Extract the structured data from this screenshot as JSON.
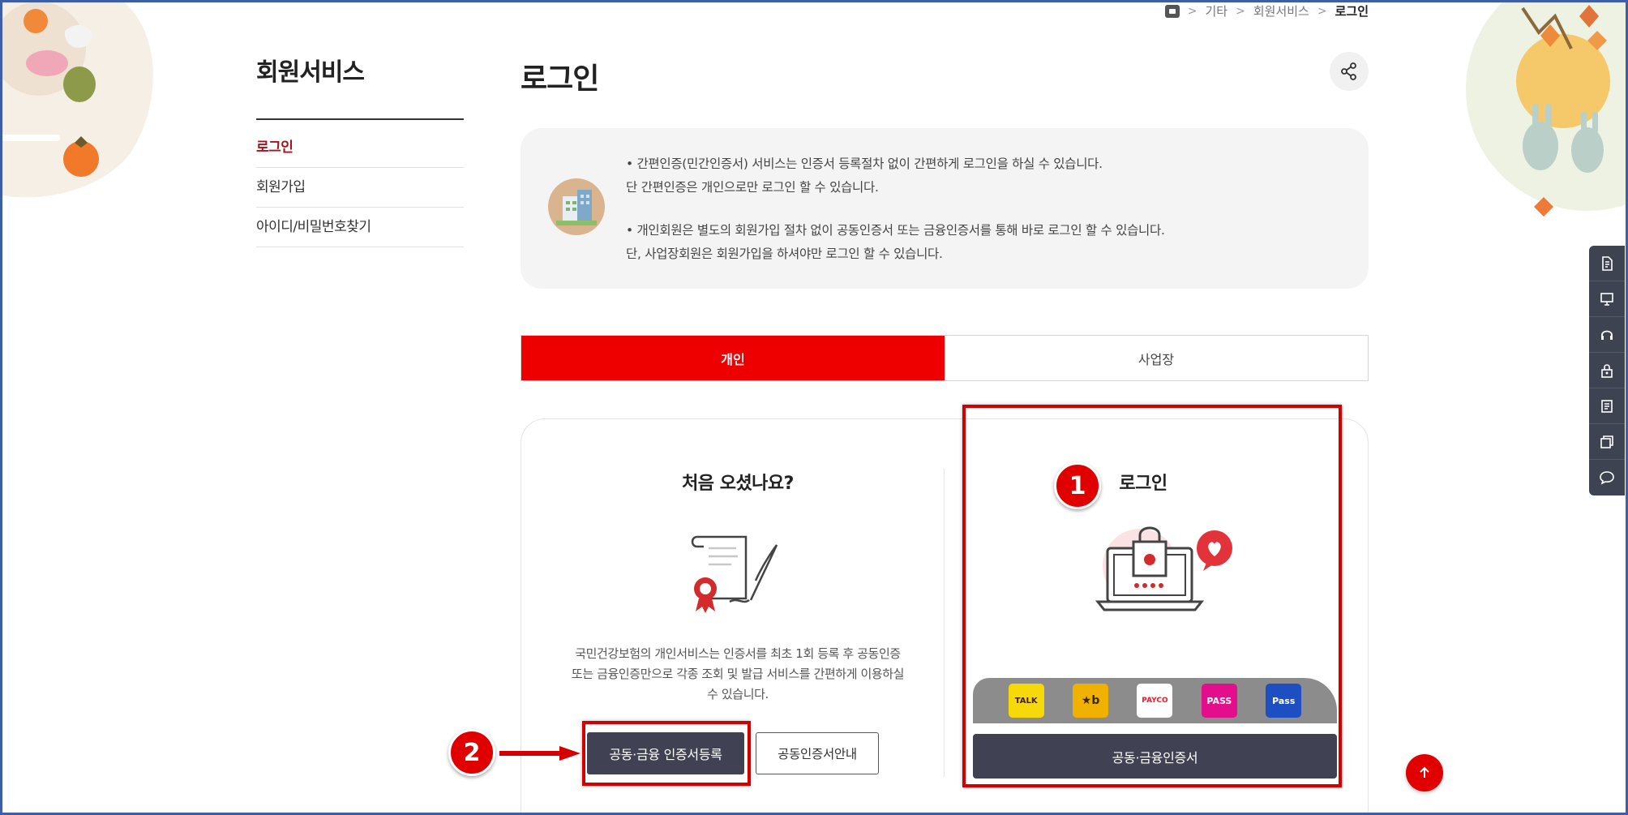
{
  "breadcrumb": {
    "items": [
      "기타",
      "회원서비스",
      "로그인"
    ]
  },
  "sidebar": {
    "title": "회원서비스",
    "items": [
      {
        "label": "로그인",
        "active": true
      },
      {
        "label": "회원가입",
        "active": false
      },
      {
        "label": "아이디/비밀번호찾기",
        "active": false
      }
    ]
  },
  "main": {
    "title": "로그인",
    "info": {
      "lines": [
        "• 간편인증(민간인증서) 서비스는 인증서 등록절차 없이 간편하게 로그인을 하실 수 있습니다.",
        "단 간편인증은 개인으로만 로그인 할 수 있습니다.",
        "• 개인회원은 별도의 회원가입 절차 없이 공동인증서 또는 금융인증서를 통해 바로 로그인 할 수 있습니다.",
        "단, 사업장회원은 회원가입을 하셔야만 로그인 할 수 있습니다."
      ]
    },
    "tabs": [
      {
        "label": "개인",
        "active": true
      },
      {
        "label": "사업장",
        "active": false
      }
    ],
    "first_visit": {
      "title": "처음 오셨나요?",
      "desc_line1": "국민건강보험의 개인서비스는 인증서를 최초 1회 등록 후 공동인증",
      "desc_line2": "또는 금융인증만으로 각종 조회 및 발급 서비스를 간편하게 이용하실",
      "desc_line3": "수 있습니다.",
      "register_button": "공동·금융 인증서등록",
      "guide_button": "공동인증서안내"
    },
    "login": {
      "title": "로그인",
      "auth_options": {
        "kakao": "TALK",
        "kb": "★b",
        "payco": "PAYCO",
        "pass": "PASS",
        "pass_blue": "Pass"
      },
      "cert_button": "공동·금융인증서"
    }
  },
  "annotations": {
    "badge1": "1",
    "badge2": "2"
  },
  "colors": {
    "accent_red": "#ee0000",
    "dark_button": "#404253",
    "sidebar_active": "#a3141d"
  }
}
